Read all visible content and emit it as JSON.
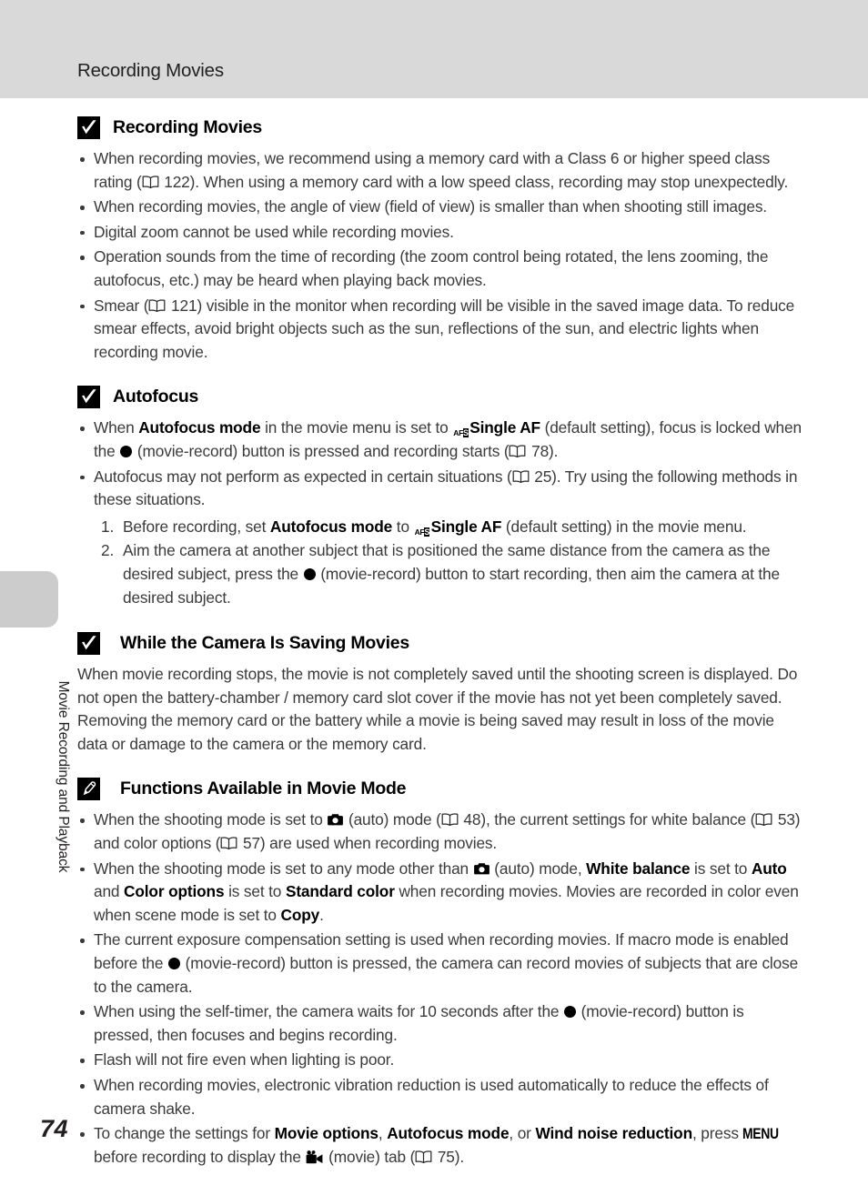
{
  "header": {
    "title": "Recording Movies"
  },
  "side_tab": {
    "label": "Movie Recording and Playback"
  },
  "page_number": "74",
  "icons": {
    "check": "checkmark-box-icon",
    "pencil": "pencil-box-icon",
    "book": "open-book-icon",
    "af_single": "af-single-icon",
    "record_dot": "movie-record-dot-icon",
    "camera": "camera-auto-mode-icon",
    "movie_tab": "movie-camera-icon",
    "menu": "MENU"
  },
  "sections": [
    {
      "id": "recording-movies",
      "icon": "check",
      "title": "Recording Movies",
      "bullets": [
        {
          "parts": [
            {
              "t": "text",
              "v": "When recording movies, we recommend using a memory card with a Class 6 or higher speed class rating ("
            },
            {
              "t": "book"
            },
            {
              "t": "text",
              "v": " 122). When using a memory card with a low speed class, recording may stop unexpectedly."
            }
          ]
        },
        {
          "parts": [
            {
              "t": "text",
              "v": "When recording movies, the angle of view (field of view) is smaller than when shooting still images."
            }
          ]
        },
        {
          "parts": [
            {
              "t": "text",
              "v": "Digital zoom cannot be used while recording movies."
            }
          ]
        },
        {
          "parts": [
            {
              "t": "text",
              "v": "Operation sounds from the time of recording (the zoom control being rotated, the lens zooming, the autofocus, etc.) may be heard when playing back movies."
            }
          ]
        },
        {
          "parts": [
            {
              "t": "text",
              "v": "Smear ("
            },
            {
              "t": "book"
            },
            {
              "t": "text",
              "v": " 121) visible in the monitor when recording will be visible in the saved image data. To reduce smear effects, avoid bright objects such as the sun, reflections of the sun, and electric lights when recording movie."
            }
          ]
        }
      ]
    },
    {
      "id": "autofocus",
      "icon": "check",
      "title": "Autofocus",
      "bullets": [
        {
          "parts": [
            {
              "t": "text",
              "v": "When "
            },
            {
              "t": "b",
              "v": "Autofocus mode"
            },
            {
              "t": "text",
              "v": " in the movie menu is set to "
            },
            {
              "t": "afs"
            },
            {
              "t": "b",
              "v": "Single AF"
            },
            {
              "t": "text",
              "v": " (default setting), focus is locked when the "
            },
            {
              "t": "dot"
            },
            {
              "t": "text",
              "v": " (movie-record) button is pressed and recording starts ("
            },
            {
              "t": "book"
            },
            {
              "t": "text",
              "v": " 78)."
            }
          ]
        },
        {
          "parts": [
            {
              "t": "text",
              "v": "Autofocus may not perform as expected in certain situations ("
            },
            {
              "t": "book"
            },
            {
              "t": "text",
              "v": " 25). Try using the following methods in these situations."
            }
          ]
        }
      ],
      "steps": [
        {
          "parts": [
            {
              "t": "text",
              "v": "Before recording, set "
            },
            {
              "t": "b",
              "v": "Autofocus mode"
            },
            {
              "t": "text",
              "v": " to "
            },
            {
              "t": "afs"
            },
            {
              "t": "b",
              "v": "Single AF"
            },
            {
              "t": "text",
              "v": " (default setting) in the movie menu."
            }
          ]
        },
        {
          "parts": [
            {
              "t": "text",
              "v": "Aim the camera at another subject that is positioned the same distance from the camera as the desired subject, press the "
            },
            {
              "t": "dot"
            },
            {
              "t": "text",
              "v": " (movie-record) button to start recording, then aim the camera at the desired subject."
            }
          ]
        }
      ]
    },
    {
      "id": "while-saving-movies",
      "icon": "check",
      "title": "While the Camera Is Saving Movies",
      "paragraph": {
        "parts": [
          {
            "t": "text",
            "v": "When movie recording stops, the movie is not completely saved until the shooting screen is displayed. Do not open the battery-chamber / memory card slot cover if the movie has not yet been completely saved. Removing the memory card or the battery while a movie is being saved may result in loss of the movie data or damage to the camera or the memory card."
          }
        ]
      }
    },
    {
      "id": "functions-available-in-movie-mode",
      "icon": "pencil",
      "title": "Functions Available in Movie Mode",
      "bullets": [
        {
          "parts": [
            {
              "t": "text",
              "v": "When the shooting mode is set to "
            },
            {
              "t": "cam"
            },
            {
              "t": "text",
              "v": " (auto) mode ("
            },
            {
              "t": "book"
            },
            {
              "t": "text",
              "v": " 48), the current settings for white balance ("
            },
            {
              "t": "book"
            },
            {
              "t": "text",
              "v": " 53) and color options ("
            },
            {
              "t": "book"
            },
            {
              "t": "text",
              "v": " 57) are used when recording movies."
            }
          ]
        },
        {
          "parts": [
            {
              "t": "text",
              "v": "When the shooting mode is set to any mode other than "
            },
            {
              "t": "cam"
            },
            {
              "t": "text",
              "v": " (auto) mode, "
            },
            {
              "t": "b",
              "v": "White balance"
            },
            {
              "t": "text",
              "v": " is set to "
            },
            {
              "t": "b",
              "v": "Auto"
            },
            {
              "t": "text",
              "v": " and "
            },
            {
              "t": "b",
              "v": "Color options"
            },
            {
              "t": "text",
              "v": " is set to "
            },
            {
              "t": "b",
              "v": "Standard color"
            },
            {
              "t": "text",
              "v": " when recording movies. Movies are recorded in color even when scene mode is set to "
            },
            {
              "t": "b",
              "v": "Copy"
            },
            {
              "t": "text",
              "v": "."
            }
          ]
        },
        {
          "parts": [
            {
              "t": "text",
              "v": "The current exposure compensation setting is used when recording movies. If macro mode is enabled before the "
            },
            {
              "t": "dot"
            },
            {
              "t": "text",
              "v": " (movie-record) button is pressed, the camera can record movies of subjects that are close to the camera."
            }
          ]
        },
        {
          "parts": [
            {
              "t": "text",
              "v": "When using the self-timer, the camera waits for 10 seconds after the "
            },
            {
              "t": "dot"
            },
            {
              "t": "text",
              "v": " (movie-record) button is pressed, then focuses and begins recording."
            }
          ]
        },
        {
          "parts": [
            {
              "t": "text",
              "v": "Flash will not fire even when lighting is poor."
            }
          ]
        },
        {
          "parts": [
            {
              "t": "text",
              "v": "When recording movies, electronic vibration reduction is used automatically to reduce the effects of camera shake."
            }
          ]
        },
        {
          "parts": [
            {
              "t": "text",
              "v": "To change the settings for "
            },
            {
              "t": "b",
              "v": "Movie options"
            },
            {
              "t": "text",
              "v": ", "
            },
            {
              "t": "b",
              "v": "Autofocus mode"
            },
            {
              "t": "text",
              "v": ", or "
            },
            {
              "t": "b",
              "v": "Wind noise reduction"
            },
            {
              "t": "text",
              "v": ", press "
            },
            {
              "t": "menu"
            },
            {
              "t": "text",
              "v": " before recording to display the "
            },
            {
              "t": "mov"
            },
            {
              "t": "text",
              "v": " (movie) tab ("
            },
            {
              "t": "book"
            },
            {
              "t": "text",
              "v": " 75)."
            }
          ]
        }
      ]
    }
  ]
}
